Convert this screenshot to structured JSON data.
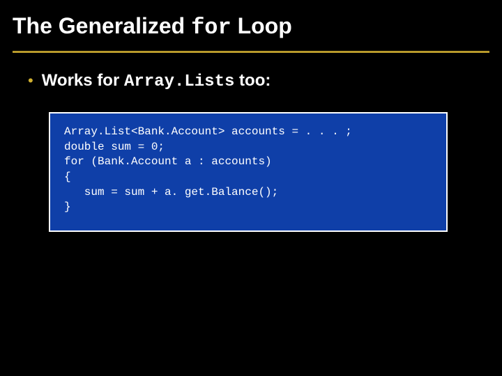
{
  "title": {
    "prefix": "The Generalized ",
    "mono": "for",
    "suffix": " Loop"
  },
  "bullet": {
    "dot": "•",
    "prefix": "Works for ",
    "mono": "Array.Lists",
    "suffix": " too:"
  },
  "code": "Array.List<Bank.Account> accounts = . . . ;\ndouble sum = 0;\nfor (Bank.Account a : accounts)\n{\n   sum = sum + a. get.Balance();\n}",
  "colors": {
    "background": "#000000",
    "accent": "#b89a2b",
    "codebox": "#0f3fa8"
  }
}
